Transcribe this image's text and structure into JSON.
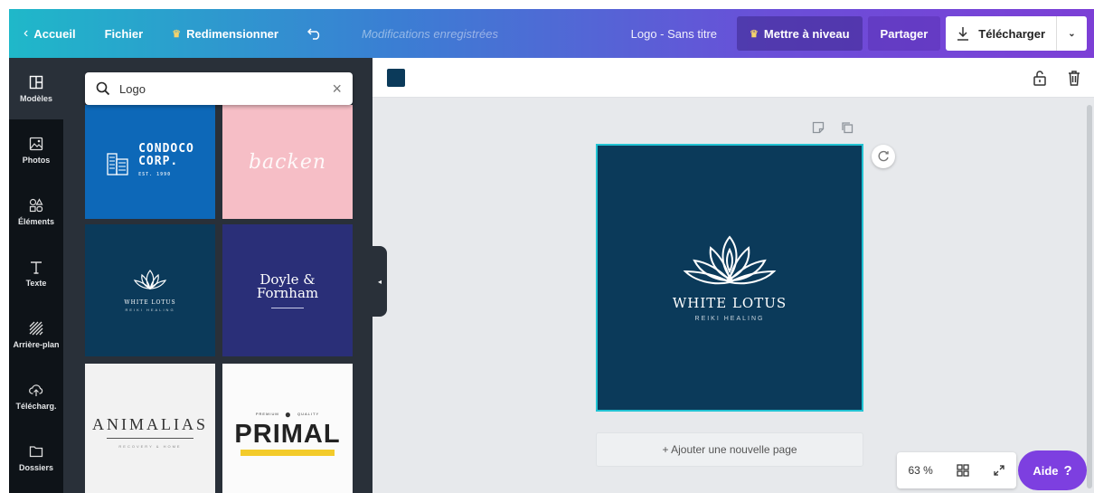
{
  "header": {
    "back_label": "Accueil",
    "file_label": "Fichier",
    "resize_label": "Redimensionner",
    "status_text": "Modifications enregistrées",
    "doc_title": "Logo - Sans titre",
    "upgrade_label": "Mettre à niveau",
    "share_label": "Partager",
    "download_label": "Télécharger"
  },
  "sidebar": {
    "items": [
      {
        "label": "Modèles",
        "icon": "templates-icon"
      },
      {
        "label": "Photos",
        "icon": "photo-icon"
      },
      {
        "label": "Éléments",
        "icon": "elements-icon"
      },
      {
        "label": "Texte",
        "icon": "text-icon"
      },
      {
        "label": "Arrière-plan",
        "icon": "background-icon"
      },
      {
        "label": "Télécharg.",
        "icon": "upload-icon"
      },
      {
        "label": "Dossiers",
        "icon": "folder-icon"
      }
    ]
  },
  "search": {
    "value": "Logo"
  },
  "templates": [
    {
      "title": "CONDOCO",
      "title2": "CORP.",
      "sub": "EST. 1990"
    },
    {
      "title": "backen"
    },
    {
      "title": "WHITE LOTUS",
      "sub": "REIKI HEALING"
    },
    {
      "title": "Doyle &",
      "title2": "Fornham"
    },
    {
      "title": "ANIMALIAS",
      "sub": "RECOVERY & HOME"
    },
    {
      "top_left": "PREMIUM",
      "top_right": "QUALITY",
      "title": "PRIMAL"
    }
  ],
  "canvas": {
    "title": "WHITE LOTUS",
    "subtitle": "REIKI HEALING",
    "add_page_label": "+ Ajouter une nouvelle page",
    "zoom": "63 %",
    "help_label": "Aide"
  },
  "colors": {
    "canvas_bg": "#0b3a5a",
    "accent_selection": "#22c3d3",
    "help_purple": "#7d3fe0"
  }
}
